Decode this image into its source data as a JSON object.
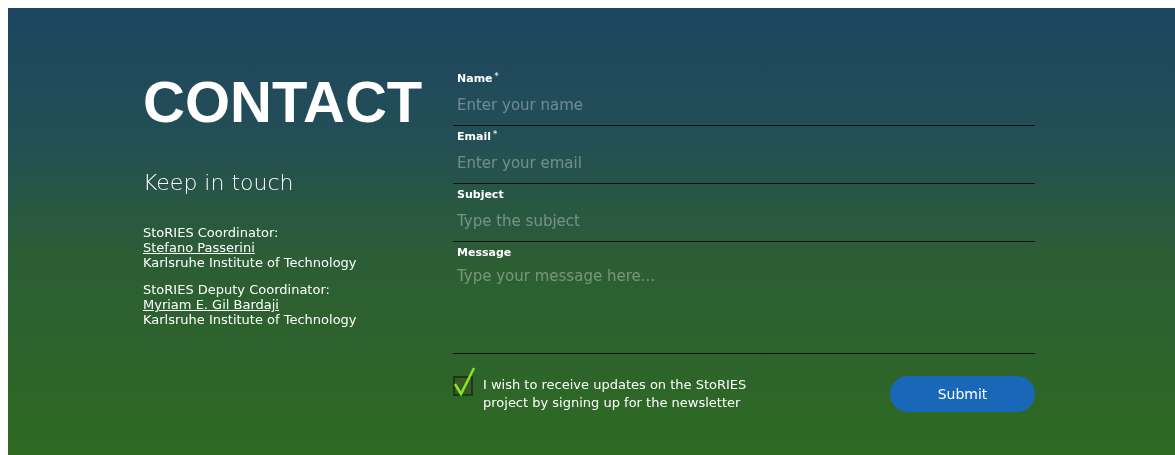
{
  "heading": "CONTACT",
  "subheading": "Keep in touch",
  "contacts": [
    {
      "role": "StoRIES Coordinator:",
      "name": "Stefano Passerini",
      "institution": "Karlsruhe Institute of Technology"
    },
    {
      "role": "StoRIES Deputy Coordinator:",
      "name": "Myriam E. Gil Bardaji",
      "institution": "Karlsruhe Institute of Technology"
    }
  ],
  "form": {
    "fields": [
      {
        "kind": "input",
        "label": "Name",
        "required_mark": "*",
        "placeholder": "Enter your name"
      },
      {
        "kind": "input",
        "label": "Email",
        "required_mark": "*",
        "placeholder": "Enter your email"
      },
      {
        "kind": "input",
        "label": "Subject",
        "placeholder": "Type the subject"
      },
      {
        "kind": "textarea",
        "label": "Message",
        "placeholder": "Type your message here..."
      }
    ],
    "newsletter": {
      "label": "I wish to receive updates on the StoRIES project by signing up for the newsletter",
      "checked": true
    },
    "submit": "Submit"
  }
}
